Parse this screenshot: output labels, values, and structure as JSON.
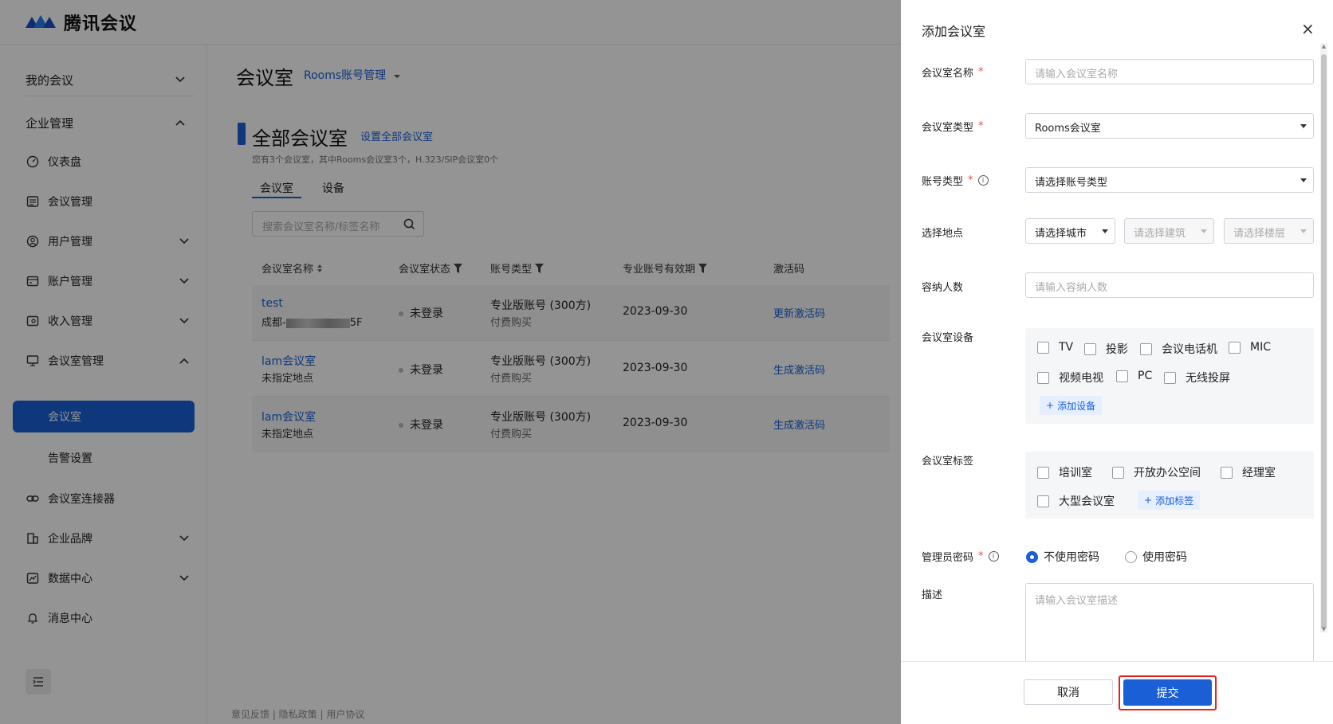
{
  "app": {
    "name": "腾讯会议"
  },
  "sidebar": {
    "groups": [
      {
        "label": "我的会议"
      },
      {
        "label": "企业管理"
      }
    ],
    "items": [
      {
        "label": "仪表盘"
      },
      {
        "label": "会议管理"
      },
      {
        "label": "用户管理"
      },
      {
        "label": "账户管理"
      },
      {
        "label": "收入管理"
      },
      {
        "label": "会议室管理"
      },
      {
        "label": "会议室连接器"
      },
      {
        "label": "企业品牌"
      },
      {
        "label": "数据中心"
      },
      {
        "label": "消息中心"
      }
    ],
    "sub_items": [
      {
        "label": "会议室"
      },
      {
        "label": "告警设置"
      }
    ]
  },
  "main": {
    "title": "会议室",
    "crumb": "Rooms账号管理",
    "panel_title": "全部会议室",
    "panel_link": "设置全部会议室",
    "panel_sub": "您有3个会议室，其中Rooms会议室3个，H.323/SIP会议室0个",
    "tabs": [
      {
        "label": "会议室"
      },
      {
        "label": "设备"
      }
    ],
    "search_placeholder": "搜索会议室名称/标签名称",
    "columns": [
      "会议室名称",
      "会议室状态",
      "账号类型",
      "专业账号有效期",
      "激活码"
    ],
    "rows": [
      {
        "name": "test",
        "location": "成都-",
        "location_suffix": "5F",
        "status": "未登录",
        "account_type": "专业版账号 (300方)",
        "account_sub": "付费购买",
        "expiry": "2023-09-30",
        "code": "更新激活码"
      },
      {
        "name": "lam会议室",
        "location": "未指定地点",
        "status": "未登录",
        "account_type": "专业版账号 (300方)",
        "account_sub": "付费购买",
        "expiry": "2023-09-30",
        "code": "生成激活码"
      },
      {
        "name": "lam会议室",
        "location": "未指定地点",
        "status": "未登录",
        "account_type": "专业版账号 (300方)",
        "account_sub": "付费购买",
        "expiry": "2023-09-30",
        "code": "生成激活码"
      }
    ],
    "footer": "意见反馈 | 隐私政策 | 用户协议"
  },
  "drawer": {
    "title": "添加会议室",
    "close": "×",
    "fields": {
      "name_label": "会议室名称",
      "name_placeholder": "请输入会议室名称",
      "type_label": "会议室类型",
      "type_value": "Rooms会议室",
      "account_label": "账号类型",
      "account_placeholder": "请选择账号类型",
      "location_label": "选择地点",
      "city_placeholder": "请选择城市",
      "building_placeholder": "请选择建筑",
      "floor_placeholder": "请选择楼层",
      "capacity_label": "容纳人数",
      "capacity_placeholder": "请输入容纳人数",
      "devices_label": "会议室设备",
      "devices": [
        "TV",
        "投影",
        "会议电话机",
        "MIC",
        "视频电视",
        "PC",
        "无线投屏"
      ],
      "add_device": "添加设备",
      "tags_label": "会议室标签",
      "tags": [
        "培训室",
        "开放办公空间",
        "经理室",
        "大型会议室"
      ],
      "add_tag": "添加标签",
      "password_label": "管理员密码",
      "password_options": [
        "不使用密码",
        "使用密码"
      ],
      "desc_label": "描述",
      "desc_placeholder": "请输入会议室描述"
    },
    "required_mark": "*",
    "info_mark": "i",
    "cancel": "取消",
    "submit": "提交"
  },
  "colors": {
    "accent": "#1a5fd6",
    "highlight": "#e8201d",
    "required": "#e34d4d"
  }
}
